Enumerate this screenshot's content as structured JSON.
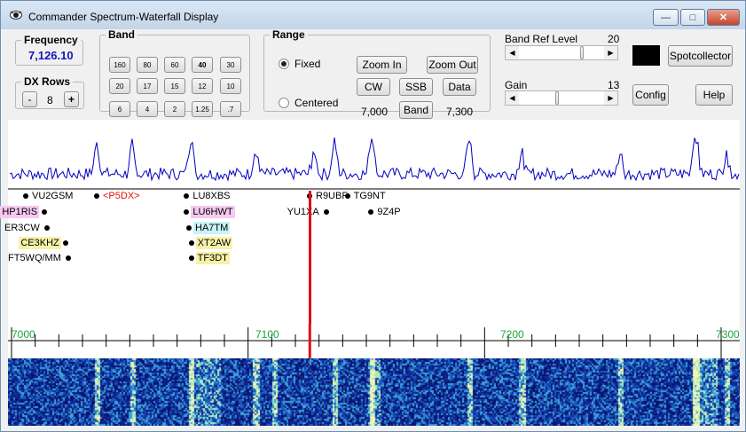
{
  "window": {
    "title": "Commander Spectrum-Waterfall Display",
    "min_glyph": "—",
    "max_glyph": "□",
    "close_glyph": "✕"
  },
  "frequency": {
    "legend": "Frequency",
    "value": "7,126.10"
  },
  "dx_rows": {
    "legend": "DX Rows",
    "minus": "-",
    "value": "8",
    "plus": "+"
  },
  "band": {
    "legend": "Band",
    "row1": [
      "160",
      "80",
      "60",
      "40",
      "30"
    ],
    "row2": [
      "20",
      "17",
      "15",
      "12",
      "10"
    ],
    "row3": [
      "6",
      "4",
      "2",
      "1.25",
      ".7"
    ],
    "selected": "40"
  },
  "range": {
    "legend": "Range",
    "fixed": "Fixed",
    "centered": "Centered",
    "zoom_in": "Zoom In",
    "zoom_out": "Zoom Out",
    "cw": "CW",
    "ssb": "SSB",
    "data": "Data",
    "band": "Band",
    "low": "7,000",
    "high": "7,300"
  },
  "band_ref": {
    "label": "Band Ref Level",
    "value": "20",
    "level": 0.75
  },
  "gain": {
    "label": "Gain",
    "value": "13",
    "level": 0.45
  },
  "buttons": {
    "spotcollector": "Spotcollector",
    "config": "Config",
    "help": "Help"
  },
  "colors": {
    "spectrum": "#0000c0",
    "cursor": "#e01010",
    "scale_text": "#17a83a"
  },
  "scale": {
    "labels": [
      "7000",
      "7100",
      "7200",
      "7300"
    ]
  },
  "tuned_frequency_khz": 7126.1,
  "spots": [
    {
      "call": "VU2GSM",
      "freq": 7006,
      "row": 0,
      "color": "#000000",
      "bg": "transparent"
    },
    {
      "call": "<P5DX>",
      "freq": 7036,
      "row": 0,
      "color": "#e01010",
      "bg": "transparent"
    },
    {
      "call": "LU8XBS",
      "freq": 7074,
      "row": 0,
      "color": "#000000",
      "bg": "transparent"
    },
    {
      "call": "R9UBF",
      "freq": 7126,
      "row": 0,
      "color": "#000000",
      "bg": "transparent"
    },
    {
      "call": "TG9NT",
      "freq": 7142,
      "row": 0,
      "color": "#000000",
      "bg": "transparent"
    },
    {
      "call": "HP1RIS",
      "freq": 7014,
      "row": 1,
      "color": "#000000",
      "bg": "#f7c9f2"
    },
    {
      "call": "LU6HWT",
      "freq": 7074,
      "row": 1,
      "color": "#000000",
      "bg": "#f7c9f2"
    },
    {
      "call": "YU1XA",
      "freq": 7133,
      "row": 1,
      "color": "#000000",
      "bg": "transparent"
    },
    {
      "call": "9Z4P",
      "freq": 7152,
      "row": 1,
      "color": "#000000",
      "bg": "transparent"
    },
    {
      "call": "ER3CW",
      "freq": 7015,
      "row": 2,
      "color": "#000000",
      "bg": "transparent"
    },
    {
      "call": "HA7TM",
      "freq": 7075,
      "row": 2,
      "color": "#000000",
      "bg": "#c8f3f7"
    },
    {
      "call": "CE3KHZ",
      "freq": 7023,
      "row": 3,
      "color": "#000000",
      "bg": "#f7f2a8"
    },
    {
      "call": "XT2AW",
      "freq": 7076,
      "row": 3,
      "color": "#000000",
      "bg": "#f7f2a8"
    },
    {
      "call": "FT5WQ/MM",
      "freq": 7024,
      "row": 4,
      "color": "#000000",
      "bg": "transparent"
    },
    {
      "call": "TF3DT",
      "freq": 7076,
      "row": 4,
      "color": "#000000",
      "bg": "#f7f2a8"
    }
  ]
}
